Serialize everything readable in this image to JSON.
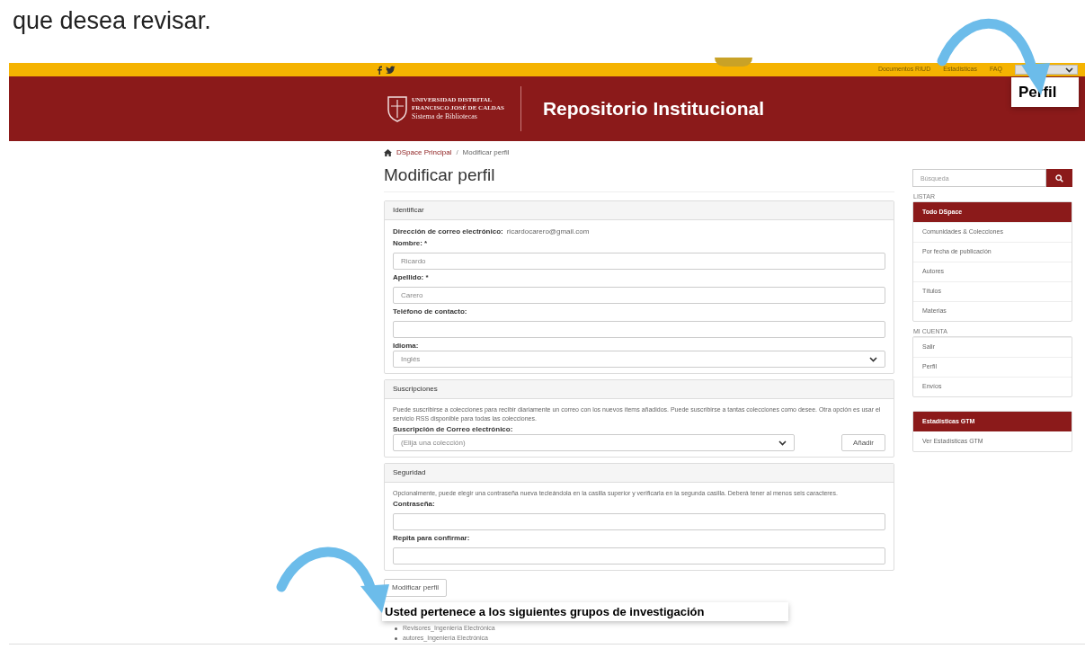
{
  "document_text": "que desea revisar.",
  "top_bar": {
    "links": [
      "Documentos RIUD",
      "Estadísticas",
      "FAQ"
    ]
  },
  "header": {
    "logo_lines": [
      "UNIVERSIDAD DISTRITAL",
      "FRANCISCO JOSÉ DE CALDAS",
      "Sistema de Bibliotecas"
    ],
    "title": "Repositorio Institucional"
  },
  "callouts": {
    "top": "Perfil",
    "bottom": "Usted pertenece a los siguientes grupos de investigación"
  },
  "breadcrumb": [
    "DSpace Principal",
    "/",
    "Modificar perfil"
  ],
  "page_title": "Modificar perfil",
  "panels": [
    {
      "title": "Identificar",
      "fields": [
        {
          "kind": "static",
          "label": "Dirección de correo electrónico:",
          "value": "ricardocarero@gmail.com"
        },
        {
          "kind": "text",
          "label": "Nombre: *",
          "value": "Ricardo"
        },
        {
          "kind": "text",
          "label": "Apellido: *",
          "value": "Carero"
        },
        {
          "kind": "text",
          "label": "Teléfono de contacto:"
        },
        {
          "kind": "select",
          "label": "Idioma:",
          "value": "Inglés"
        }
      ]
    },
    {
      "title": "Suscripciones",
      "text": "Puede suscribirse a colecciones para recibir diariamente un correo con los nuevos ítems añadidos. Puede suscribirse a tantas colecciones como desee. Otra opción es usar el servicio RSS disponible para todas las colecciones.",
      "fields": [
        {
          "kind": "select_button",
          "label": "Suscripción de Correo electrónico:",
          "value": "(Elija una colección)",
          "button": "Añadir"
        }
      ]
    },
    {
      "title": "Seguridad",
      "text": "Opcionalmente, puede elegir una contraseña nueva tecleándola en la casilla superior y verificarla en la segunda casilla. Deberá tener al menos seis caracteres.",
      "fields": [
        {
          "kind": "text",
          "label": "Contraseña:"
        },
        {
          "kind": "text",
          "label": "Repita para confirmar:"
        }
      ]
    }
  ],
  "submit_button": "Modificar perfil",
  "groups": [
    "Revisores_Ingeniería Electrónica",
    "autores_Ingeniería Electrónica"
  ],
  "sidebar": {
    "search": {
      "placeholder": "Búsqueda"
    },
    "sections": [
      {
        "heading": "LISTAR",
        "items": [
          {
            "label": "Todo DSpace",
            "selected": true
          },
          {
            "label": "Comunidades & Colecciones",
            "selected": false
          },
          {
            "label": "Por fecha de publicación",
            "selected": false
          },
          {
            "label": "Autores",
            "selected": false
          },
          {
            "label": "Títulos",
            "selected": false
          },
          {
            "label": "Materias",
            "selected": false
          }
        ]
      },
      {
        "heading": "MI CUENTA",
        "items": [
          {
            "label": "Salir",
            "selected": false
          },
          {
            "label": "Perfil",
            "selected": false
          },
          {
            "label": "Envíos",
            "selected": false
          }
        ]
      }
    ],
    "stats": {
      "title": "Estadísticas GTM",
      "link": "Ver Estadísticas GTM"
    }
  }
}
